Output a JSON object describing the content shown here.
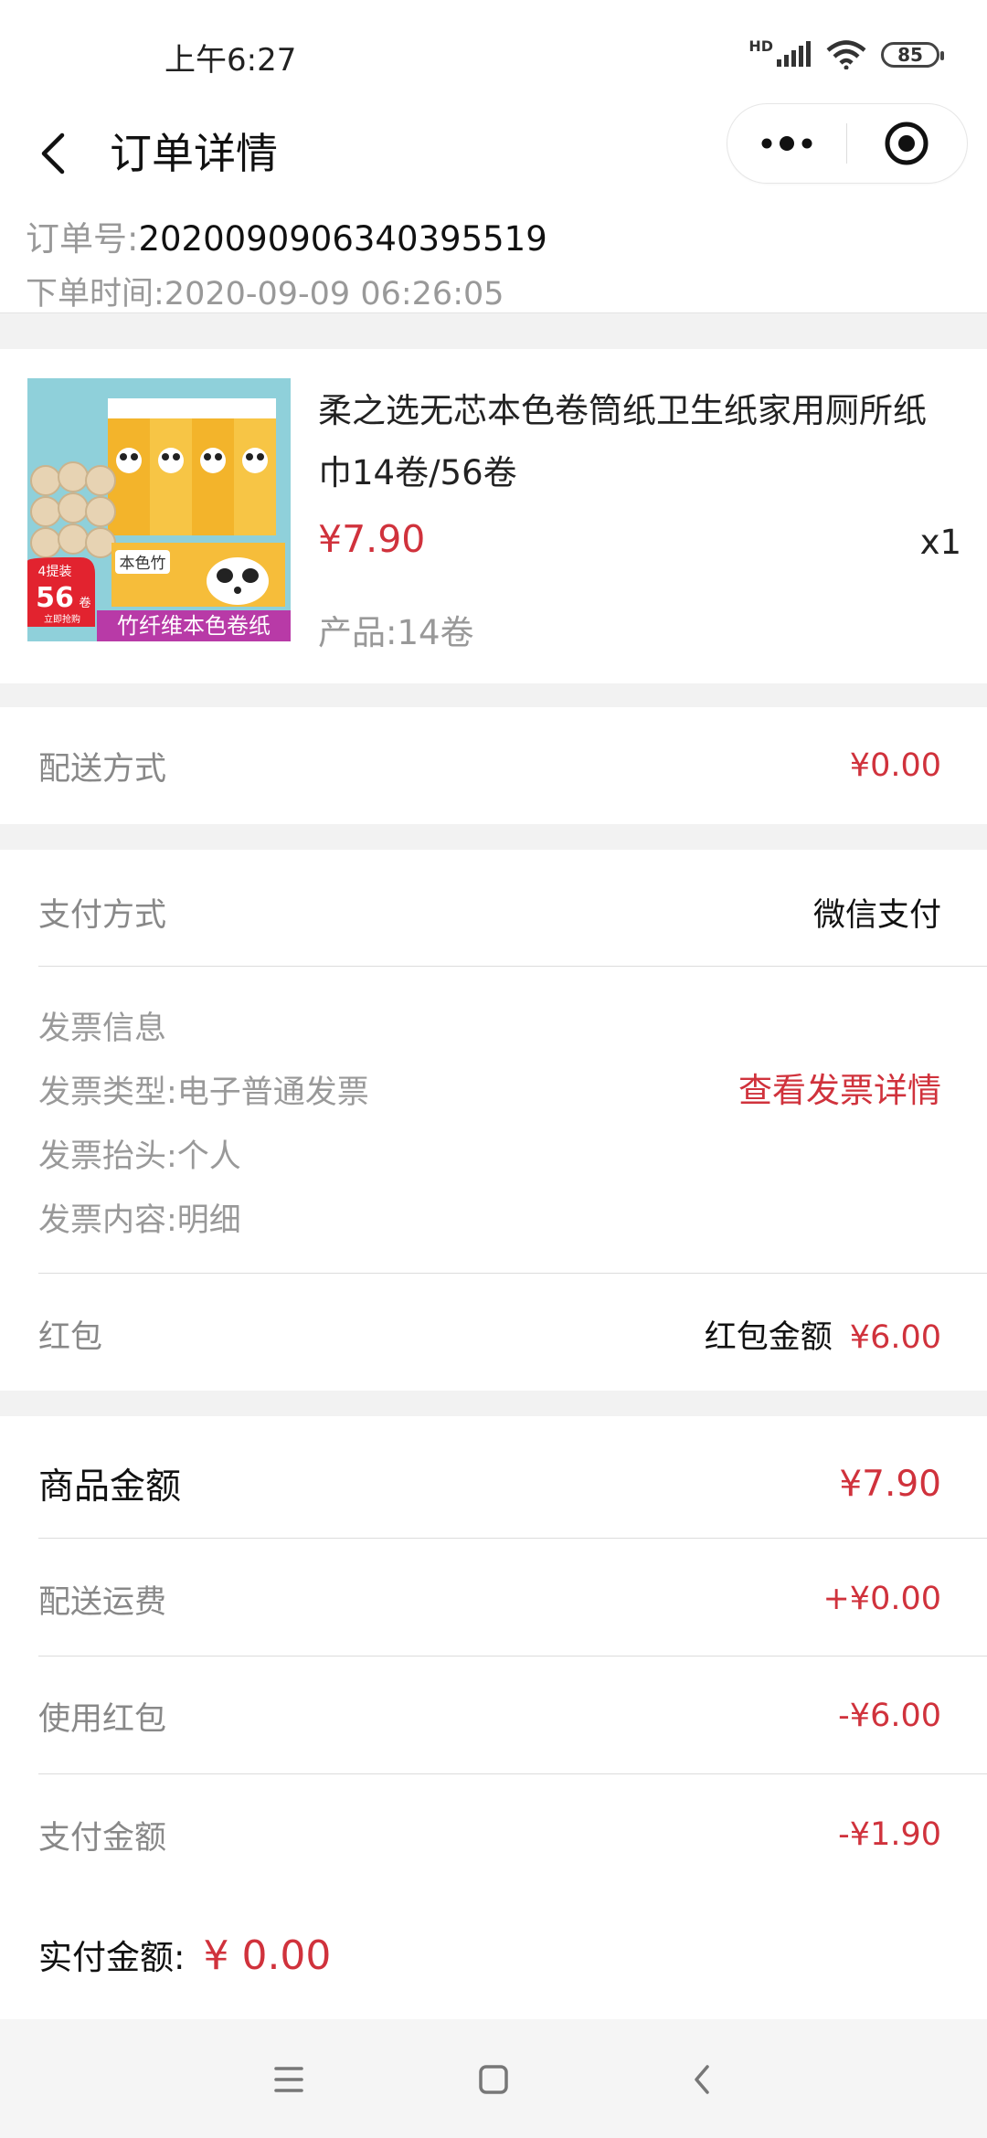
{
  "status": {
    "time": "上午6:27",
    "hd_label": "HD",
    "battery": "85"
  },
  "header": {
    "title": "订单详情"
  },
  "order": {
    "number_label": "订单号:",
    "number": "2020090906340395519",
    "time_label": "下单时间:",
    "time": "2020-09-09 06:26:05"
  },
  "product": {
    "name": "柔之选无芯本色卷筒纸卫生纸家用厕所纸巾14卷/56卷",
    "price": "¥7.90",
    "qty": "x1",
    "spec": "产品:14卷",
    "image_badge_top": "4提装",
    "image_badge_num": "56",
    "image_badge_unit": "卷",
    "image_badge_sub": "立即抢购",
    "image_pkg_brand": "本色竹",
    "image_banner": "竹纤维本色卷纸"
  },
  "delivery": {
    "label": "配送方式",
    "value": "¥0.00"
  },
  "payment": {
    "label": "支付方式",
    "value": "微信支付"
  },
  "invoice": {
    "title": "发票信息",
    "type_line": "发票类型:电子普通发票",
    "header_line": "发票抬头:个人",
    "content_line": "发票内容:明细",
    "link": "查看发票详情"
  },
  "redpacket": {
    "label": "红包",
    "amount_label": "红包金额",
    "amount": "¥6.00"
  },
  "summary": {
    "goods_label": "商品金额",
    "goods_value": "¥7.90",
    "shipping_label": "配送运费",
    "shipping_value": "+¥0.00",
    "redpacket_label": "使用红包",
    "redpacket_value": "-¥6.00",
    "pay_label": "支付金额",
    "pay_value": "-¥1.90",
    "final_label": "实付金额:",
    "final_value": "¥ 0.00"
  },
  "colors": {
    "accent_red": "#d0323c",
    "label_grey": "#999999",
    "background": "#f2f2f2"
  }
}
